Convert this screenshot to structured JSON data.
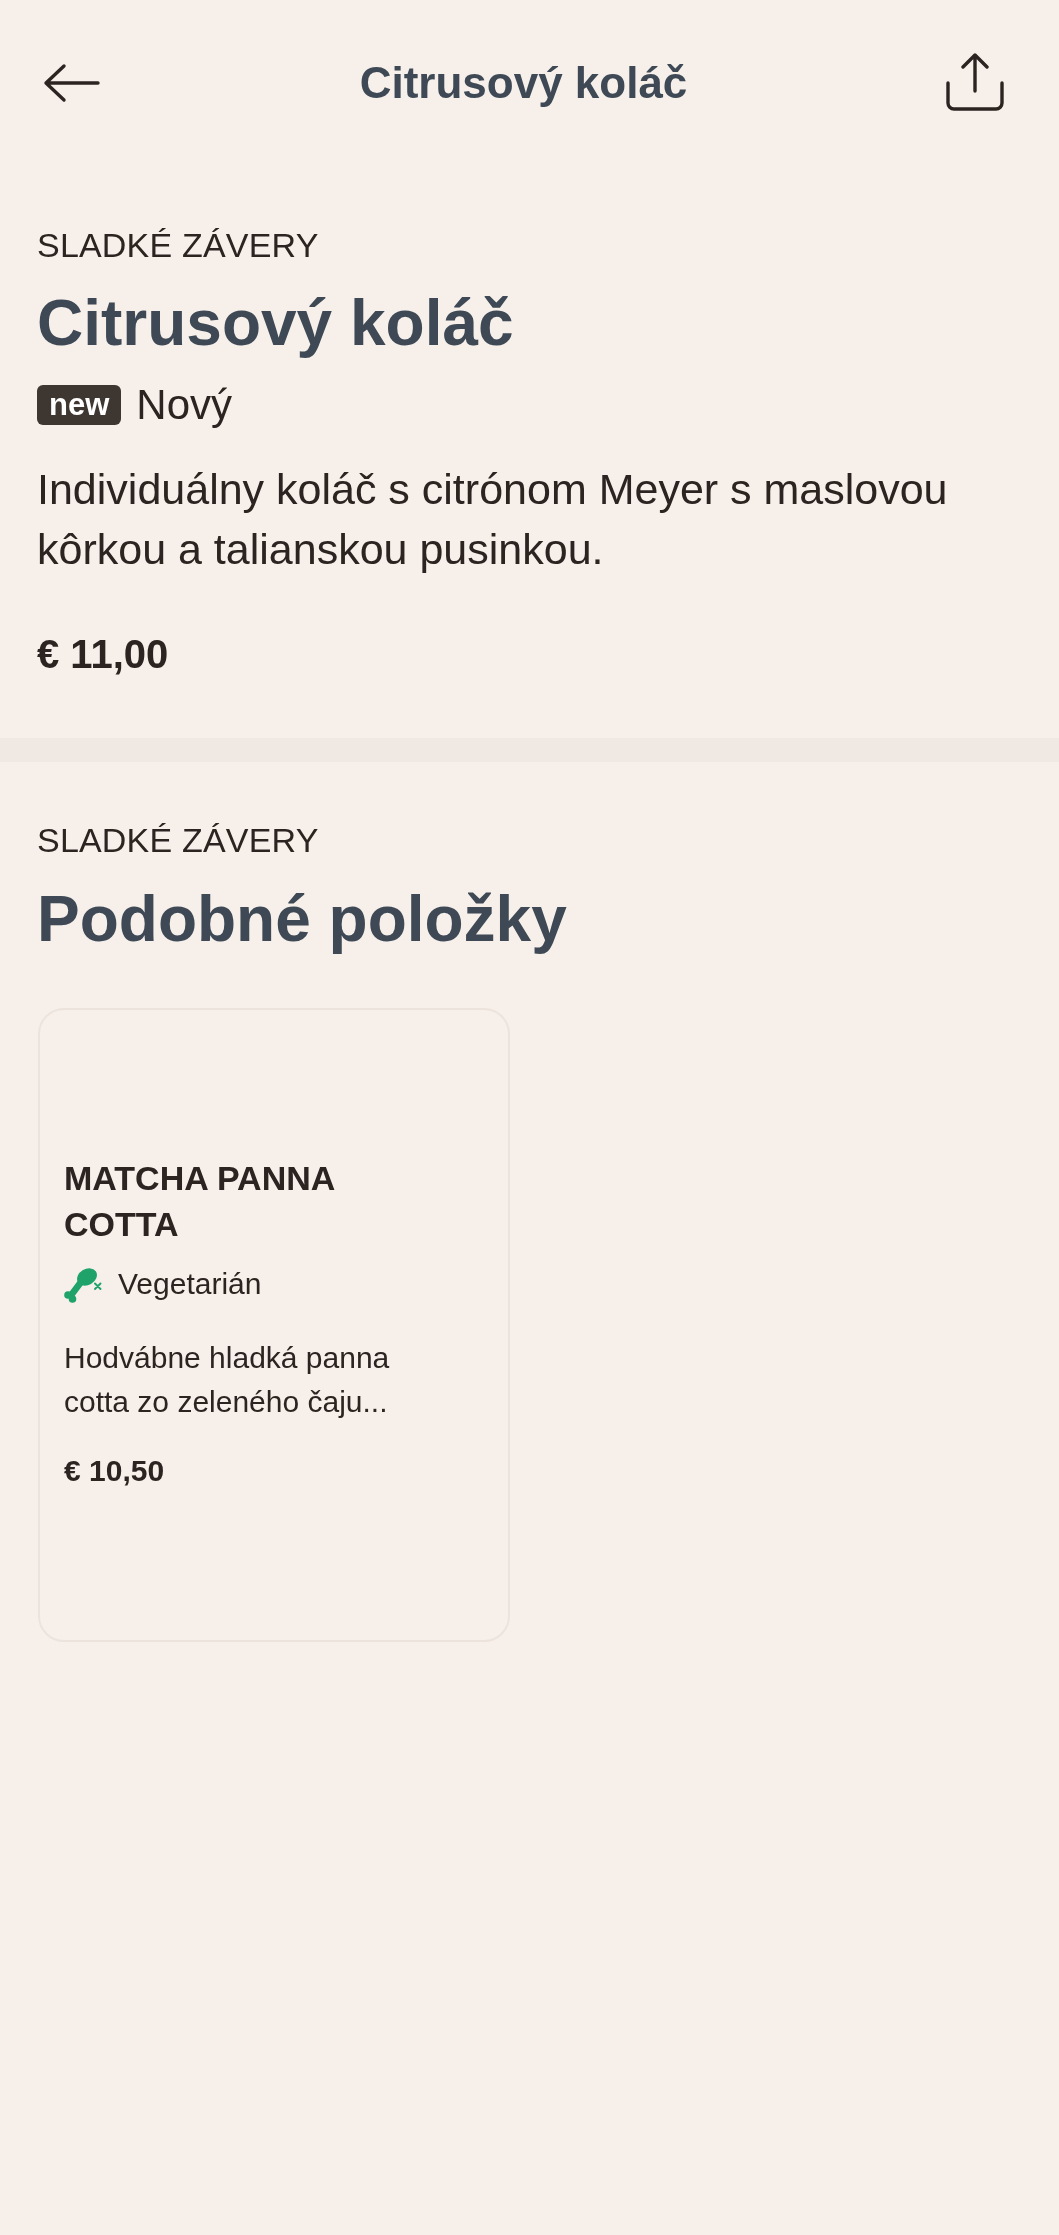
{
  "top_bar": {
    "title": "Citrusový koláč"
  },
  "item": {
    "category": "SLADKÉ ZÁVERY",
    "name": "Citrusový koláč",
    "badge": "new",
    "badge_label": "Nový",
    "description": "Individuálny koláč s citrónom Meyer s maslovou kôrkou a talianskou pusinkou.",
    "price": "€ 11,00"
  },
  "similar": {
    "category": "SLADKÉ ZÁVERY",
    "title": "Podobné položky",
    "items": [
      {
        "name": "MATCHA PANNA COTTA",
        "diet": [
          {
            "kind": "vegetarian",
            "label": "Vegetarián"
          }
        ],
        "description": "Hodvábne hladká panna cotta zo zeleného čaju...",
        "price": "€ 10,50"
      }
    ]
  }
}
